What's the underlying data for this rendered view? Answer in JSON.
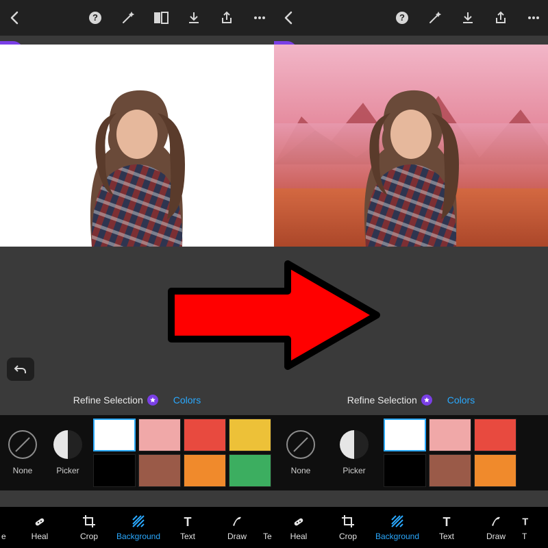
{
  "topbar": {
    "icons": [
      "help",
      "magic-wand",
      "compare",
      "download",
      "share",
      "more"
    ],
    "icons_right_panel": [
      "help",
      "magic-wand",
      "download",
      "share",
      "more"
    ]
  },
  "refine": {
    "label": "Refine Selection",
    "colors_label": "Colors"
  },
  "choices": {
    "none": "None",
    "picker": "Picker"
  },
  "swatches_left": [
    "white",
    "pink",
    "red",
    "gold",
    "black",
    "brown",
    "orange",
    "green"
  ],
  "swatches_right": [
    "white",
    "pink",
    "red",
    "black",
    "brown",
    "orange"
  ],
  "selected_swatch": "white",
  "tools": [
    {
      "id": "heal",
      "label": "Heal"
    },
    {
      "id": "crop",
      "label": "Crop"
    },
    {
      "id": "background",
      "label": "Background",
      "active": true
    },
    {
      "id": "text",
      "label": "Text"
    },
    {
      "id": "draw",
      "label": "Draw"
    }
  ],
  "tool_cutoff_left": {
    "id": "te",
    "label": "Te"
  },
  "tool_cutoff_right": {
    "id": "text2",
    "label": "T"
  },
  "tool_leading_left": {
    "id": "heal0",
    "label": "e"
  },
  "colors": {
    "accent": "#2aa9ff",
    "premium": "#7a3fe6"
  }
}
